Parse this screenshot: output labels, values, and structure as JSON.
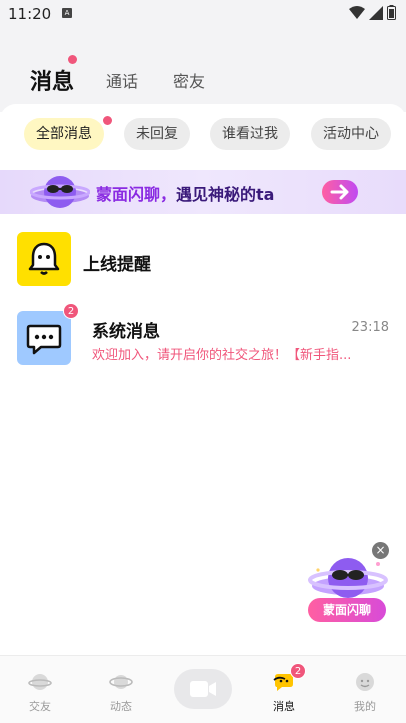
{
  "status": {
    "time": "11:20",
    "notif_icon": "A"
  },
  "top_tabs": [
    {
      "label": "消息",
      "active": true
    },
    {
      "label": "通话",
      "active": false
    },
    {
      "label": "密友",
      "active": false
    }
  ],
  "chips": [
    {
      "label": "全部消息",
      "active": true
    },
    {
      "label": "未回复",
      "active": false
    },
    {
      "label": "谁看过我",
      "active": false
    },
    {
      "label": "活动中心",
      "active": false
    }
  ],
  "banner": {
    "part1": "蒙面闪聊，",
    "part2": "遇见神秘的ta"
  },
  "rows": [
    {
      "title": "上线提醒",
      "icon": "bell-icon"
    },
    {
      "title": "系统消息",
      "time": "23:18",
      "preview": "欢迎加入，请开启你的社交之旅！【新手指...",
      "badge": "2",
      "icon": "chat-icon"
    }
  ],
  "floating": {
    "label": "蒙面闪聊",
    "close": "×"
  },
  "tabbar": [
    {
      "label": "交友",
      "icon": "planet-icon",
      "active": false
    },
    {
      "label": "动态",
      "icon": "planet-ring-icon",
      "active": false
    },
    {
      "label": "",
      "icon": "video-camera-icon",
      "active": false
    },
    {
      "label": "消息",
      "icon": "message-icon",
      "active": true,
      "badge": "2"
    },
    {
      "label": "我的",
      "icon": "profile-icon",
      "active": false
    }
  ],
  "colors": {
    "accent": "#f0567b",
    "chip_active": "#fff7c2",
    "bell_bg": "#ffe000",
    "chat_bg": "#9fc9ff"
  }
}
